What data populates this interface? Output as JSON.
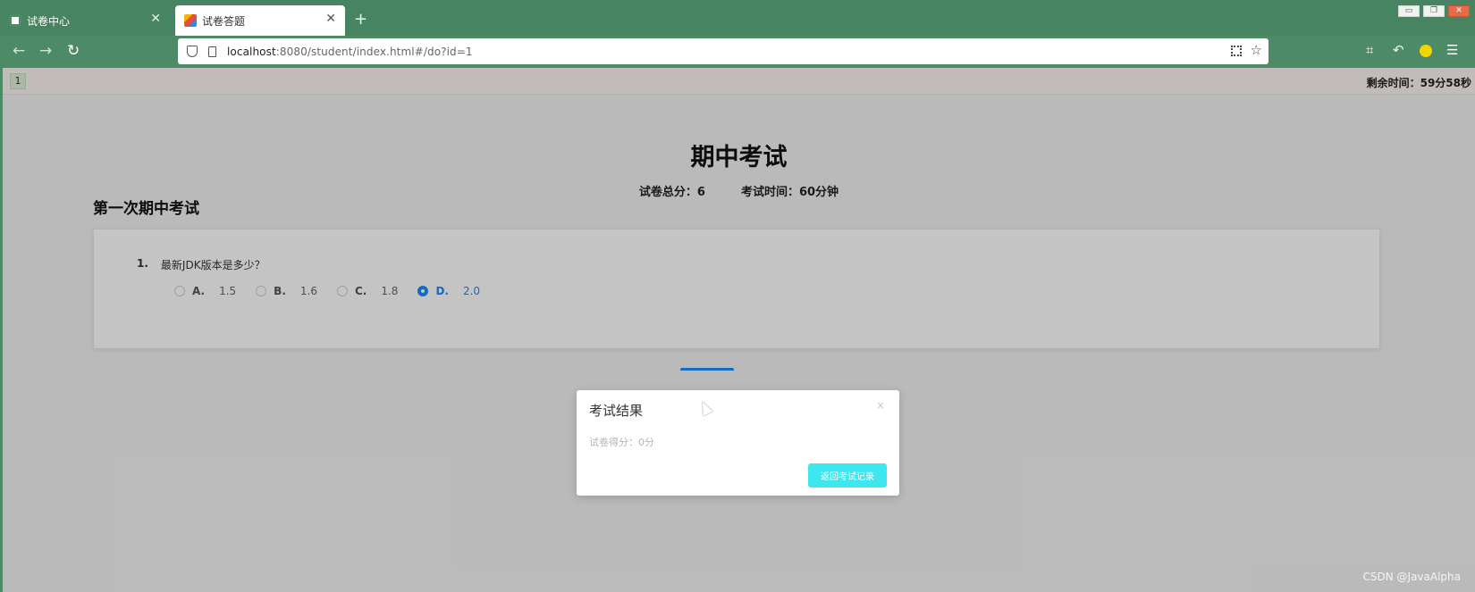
{
  "browser": {
    "tabs": [
      {
        "title": "试卷中心",
        "active": false
      },
      {
        "title": "试卷答题",
        "active": true
      }
    ],
    "new_tab": "+",
    "url_host": "localhost",
    "url_rest": ":8080/student/index.html#/do?id=1",
    "colors": {
      "chrome": "#4d8a66",
      "tabstrip": "#468462"
    }
  },
  "exam": {
    "question_nav_number": "1",
    "timer_text": "剩余时间：59分58秒",
    "title": "期中考试",
    "total_score_text": "试卷总分：6",
    "time_text": "考试时间：60分钟",
    "paper_name": "第一次期中考试",
    "question": {
      "number": "1.",
      "text": "最新JDK版本是多少？",
      "options": [
        {
          "key": "A.",
          "value": "1.5",
          "selected": false
        },
        {
          "key": "B.",
          "value": "1.6",
          "selected": false
        },
        {
          "key": "C.",
          "value": "1.8",
          "selected": false
        },
        {
          "key": "D.",
          "value": "2.0",
          "selected": true
        }
      ]
    }
  },
  "dialog": {
    "title": "考试结果",
    "close": "×",
    "body": "试卷得分：0分",
    "button_label": "返回考试记录",
    "colors": {
      "button": "#3ee6ef",
      "accent": "#1a8cff"
    }
  },
  "watermark": "CSDN @JavaAlpha"
}
